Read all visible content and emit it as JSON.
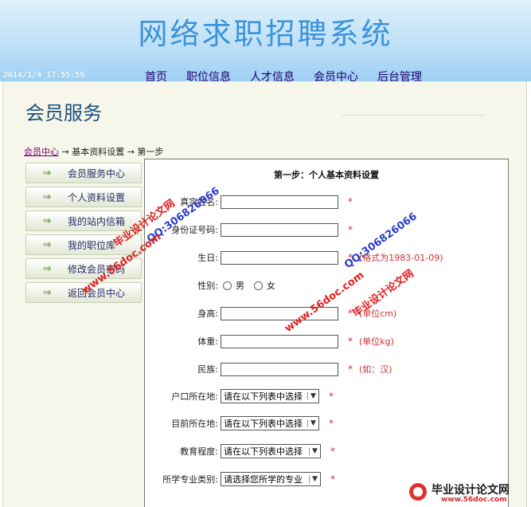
{
  "site": {
    "title": "网络求职招聘系统",
    "datetime": "2014/1/4 17:55:59"
  },
  "nav": [
    "首页",
    "职位信息",
    "人才信息",
    "会员中心",
    "后台管理"
  ],
  "page_title": "会员服务",
  "breadcrumb": {
    "link": "会员中心",
    "rest": " → 基本资料设置 → 第一步"
  },
  "sidebar": {
    "arrow": "⇒",
    "items": [
      "会员服务中心",
      "个人资料设置",
      "我的站内信箱",
      "我的职位库",
      "修改会员密码",
      "返回会员中心"
    ]
  },
  "form": {
    "heading": "第一步：个人基本资料设置",
    "required_mark": "*",
    "name_label": "真实姓名:",
    "id_label": "身份证号码:",
    "birthday_label": "生日:",
    "birthday_hint": "(格式为1983-01-09)",
    "gender_label": "性别:",
    "gender_male": "男",
    "gender_female": "女",
    "height_label": "身高:",
    "height_hint": "(单位cm)",
    "weight_label": "体重:",
    "weight_hint": "(单位kg)",
    "ethnicity_label": "民族:",
    "ethnicity_hint": "(如：汉)",
    "hukou_label": "户口所在地:",
    "hukou_value": "请在以下列表中选择",
    "current_label": "目前所在地:",
    "current_value": "请在以下列表中选择",
    "education_label": "教育程度:",
    "education_value": "请在以下列表中选择",
    "major_label": "所学专业类别:",
    "major_value": "请选择您所学的专业"
  },
  "watermarks": {
    "brand": "毕业设计论文网",
    "qq": "QQ:306826066",
    "url": "www.56doc.com"
  },
  "footer_logo": {
    "text": "毕业设计论文网",
    "url": "www.56doc.com"
  },
  "colors": {
    "header_blue": "#9ecff2",
    "title_blue": "#3b93db",
    "nav_link": "#200070",
    "required_red": "#d03030",
    "page_bg": "#f6f6ea"
  }
}
